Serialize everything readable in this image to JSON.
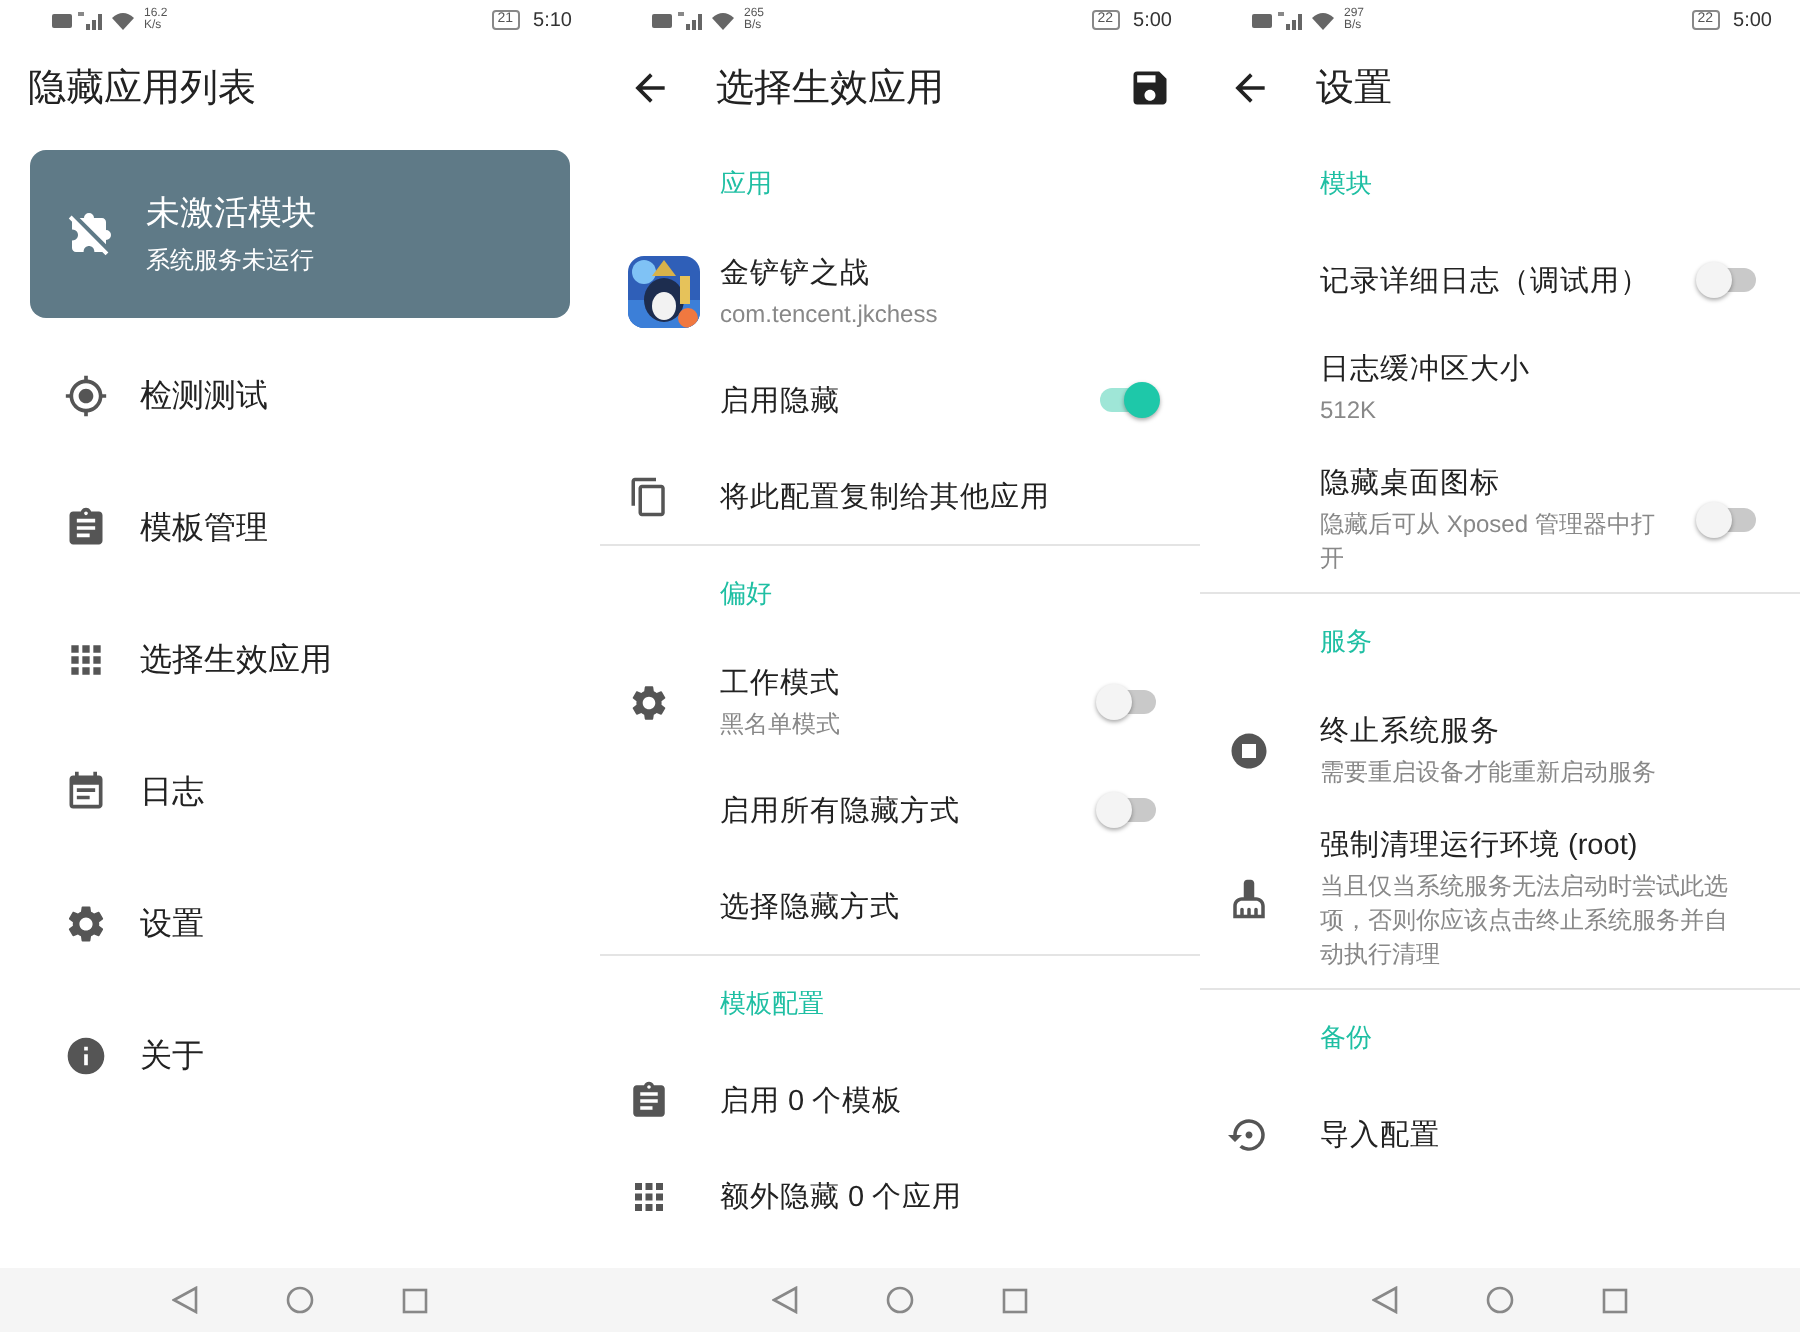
{
  "main_screen": {
    "status_bar": {
      "speed": "16.2",
      "speed_unit": "K/s",
      "battery": "21",
      "time": "5:10"
    },
    "title": "隐藏应用列表",
    "status_card": {
      "title": "未激活模块",
      "subtitle": "系统服务未运行"
    },
    "nav_items": [
      {
        "label": "检测测试"
      },
      {
        "label": "模板管理"
      },
      {
        "label": "选择生效应用"
      },
      {
        "label": "日志"
      },
      {
        "label": "设置"
      },
      {
        "label": "关于"
      }
    ]
  },
  "app_screen": {
    "status_bar": {
      "speed": "265",
      "speed_unit": "B/s",
      "battery": "22",
      "time": "5:00"
    },
    "title": "选择生效应用",
    "sections": [
      {
        "header": "应用",
        "items": [
          {
            "kind": "app",
            "title": "金铲铲之战",
            "subtitle": "com.tencent.jkchess"
          },
          {
            "kind": "toggle",
            "title": "启用隐藏",
            "on": true
          },
          {
            "kind": "plain",
            "title": "将此配置复制给其他应用"
          }
        ]
      },
      {
        "header": "偏好",
        "items": [
          {
            "kind": "toggle",
            "title": "工作模式",
            "subtitle": "黑名单模式",
            "on": false
          },
          {
            "kind": "toggle",
            "title": "启用所有隐藏方式",
            "on": false
          },
          {
            "kind": "plain",
            "title": "选择隐藏方式"
          }
        ]
      },
      {
        "header": "模板配置",
        "items": [
          {
            "kind": "plain",
            "title": "启用 0 个模板"
          },
          {
            "kind": "plain",
            "title": "额外隐藏 0 个应用"
          }
        ]
      }
    ]
  },
  "settings_screen": {
    "status_bar": {
      "speed": "297",
      "speed_unit": "B/s",
      "battery": "22",
      "time": "5:00"
    },
    "title": "设置",
    "sections": [
      {
        "header": "模块",
        "items": [
          {
            "kind": "toggle",
            "title": "记录详细日志（调试用）",
            "on": false
          },
          {
            "kind": "plain",
            "title": "日志缓冲区大小",
            "subtitle": "512K"
          },
          {
            "kind": "toggle",
            "title": "隐藏桌面图标",
            "subtitle": "隐藏后可从 Xposed 管理器中打开",
            "on": false
          }
        ]
      },
      {
        "header": "服务",
        "items": [
          {
            "kind": "plain",
            "title": "终止系统服务",
            "subtitle": "需要重启设备才能重新启动服务"
          },
          {
            "kind": "plain",
            "title": "强制清理运行环境 (root)",
            "subtitle": "当且仅当系统服务无法启动时尝试此选项，否则你应该点击终止系统服务并自动执行清理"
          }
        ]
      },
      {
        "header": "备份",
        "items": [
          {
            "kind": "plain",
            "title": "导入配置"
          }
        ]
      }
    ]
  }
}
